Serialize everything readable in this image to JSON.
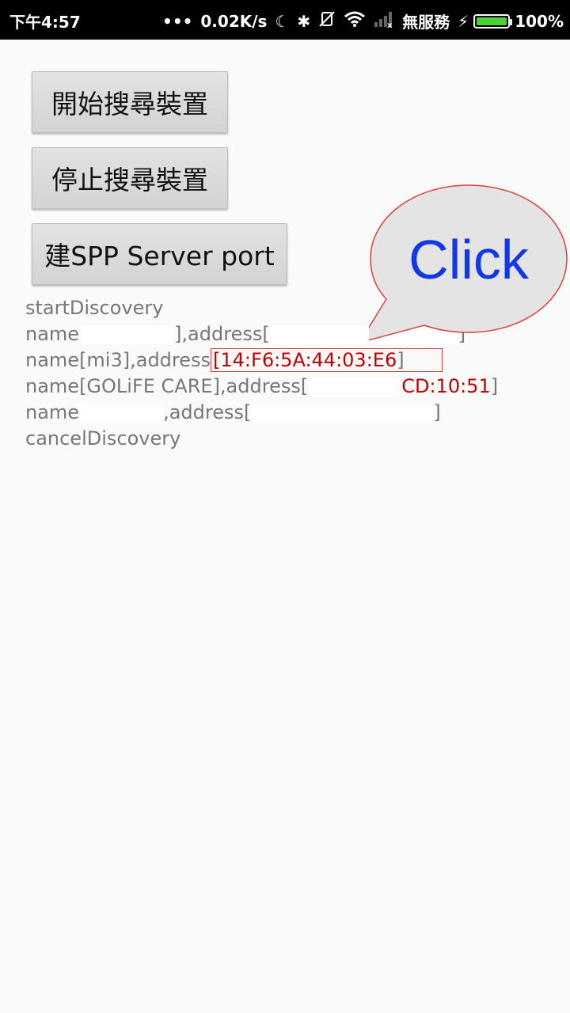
{
  "status_bar": {
    "time": "下午4:57",
    "dots": "•••",
    "speed": "0.02K/s",
    "moon_icon": "☾",
    "bluetooth_icon": "✱",
    "mute_icon": "🔕",
    "wifi_icon": "wifi",
    "signal_icon": "signal",
    "service": "無服務",
    "charging_icon": "⚡",
    "battery": "100%",
    "battery_color": "#4cd137"
  },
  "buttons": {
    "start_discovery": "開始搜尋裝置",
    "stop_discovery": "停止搜尋裝置",
    "spp_server": "建SPP Server port"
  },
  "log": {
    "line1": "startDiscovery",
    "line2_name_prefix": "name",
    "line2_address": "],address[",
    "line2_end": "]",
    "line3_name": "name[mi3],address",
    "line3_addr": "[14:F6:5A:44:03:E6",
    "line3_end": "]",
    "line4_name": "name[GOLiFE CARE],address[",
    "line4_addr": "CD:10:51",
    "line4_end": "]",
    "line5_name_prefix": "name",
    "line5_address": ",address[",
    "line5_end": "]",
    "line6": "cancelDiscovery"
  },
  "callout": {
    "text": "Click",
    "text_color": "#1038e8",
    "border_color": "#d9423a"
  }
}
